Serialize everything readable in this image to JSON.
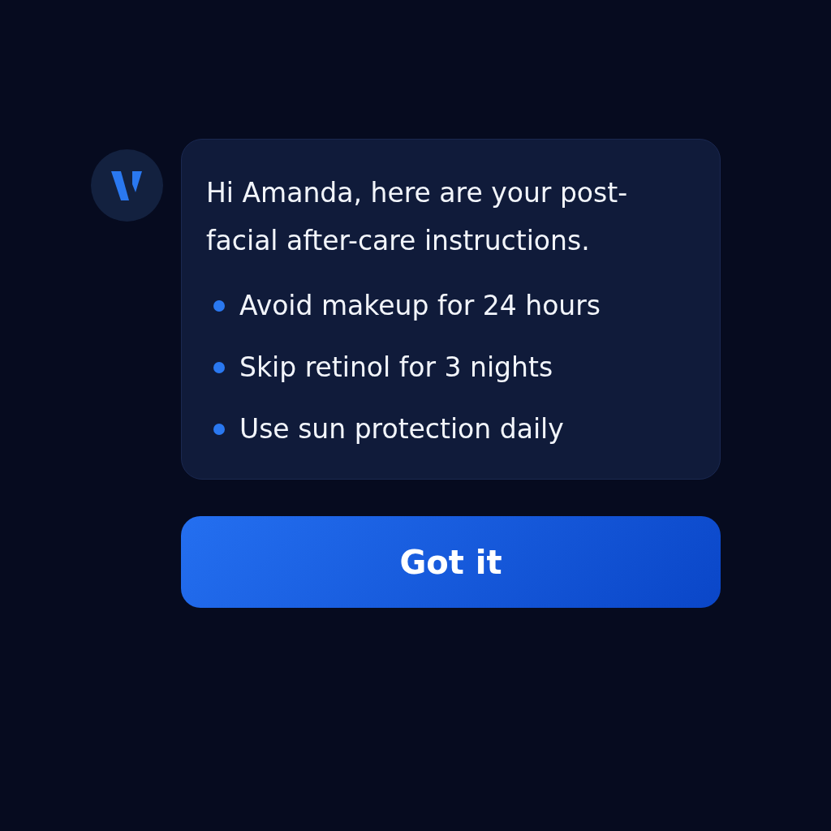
{
  "message": {
    "text": "Hi Amanda, here are your post-facial after-care instructions.",
    "items": [
      "Avoid makeup for 24 hours",
      "Skip retinol for 3 nights",
      "Use sun protection daily"
    ]
  },
  "button": {
    "label": "Got it"
  }
}
